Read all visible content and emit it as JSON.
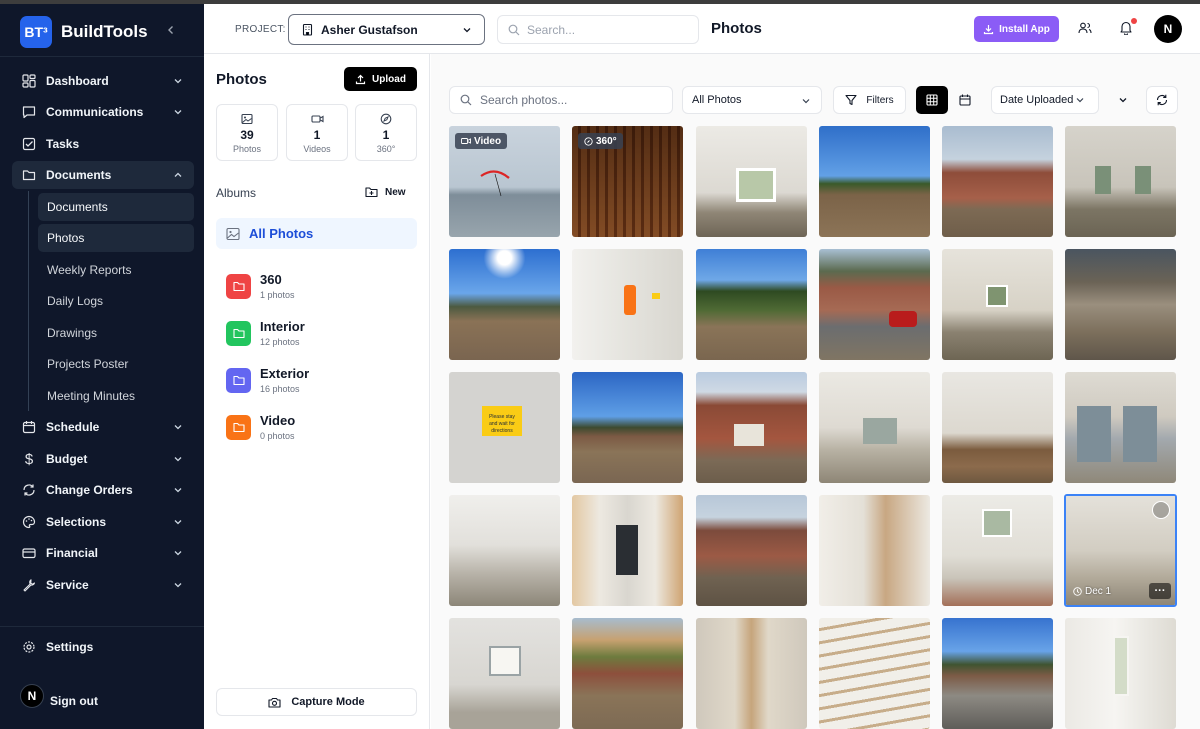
{
  "brand": {
    "logo": "BT³",
    "name": "BuildTools"
  },
  "sidebar": {
    "nav": [
      {
        "label": "Dashboard",
        "icon": "dashboard-icon"
      },
      {
        "label": "Communications",
        "icon": "chat-icon"
      },
      {
        "label": "Tasks",
        "icon": "task-check-icon"
      },
      {
        "label": "Documents",
        "icon": "folder-icon"
      },
      {
        "label": "Schedule",
        "icon": "calendar-icon"
      },
      {
        "label": "Budget",
        "icon": "dollar-icon"
      },
      {
        "label": "Change Orders",
        "icon": "refresh-icon"
      },
      {
        "label": "Selections",
        "icon": "palette-icon"
      },
      {
        "label": "Financial",
        "icon": "card-icon"
      },
      {
        "label": "Service",
        "icon": "wrench-icon"
      }
    ],
    "document_items": [
      {
        "label": "Documents"
      },
      {
        "label": "Photos"
      },
      {
        "label": "Weekly Reports"
      },
      {
        "label": "Daily Logs"
      },
      {
        "label": "Drawings"
      },
      {
        "label": "Projects Poster"
      },
      {
        "label": "Meeting Minutes"
      }
    ],
    "settings_label": "Settings",
    "signout_label": "Sign out",
    "signout_avatar": "N"
  },
  "header": {
    "project_label": "PROJECT:",
    "project_value": "Asher Gustafson",
    "search_placeholder": "Search...",
    "title": "Photos",
    "install_label": "Install App",
    "avatar": "N"
  },
  "albums_panel": {
    "title": "Photos",
    "upload_label": "Upload",
    "stats": [
      {
        "value": "39",
        "label": "Photos"
      },
      {
        "value": "1",
        "label": "Videos"
      },
      {
        "value": "1",
        "label": "360°"
      }
    ],
    "albums_heading": "Albums",
    "new_label": "New",
    "all_photos_label": "All Photos",
    "albums": [
      {
        "name": "360",
        "count": "1 photos",
        "color": "#ef4444"
      },
      {
        "name": "Interior",
        "count": "12 photos",
        "color": "#22c55e"
      },
      {
        "name": "Exterior",
        "count": "16 photos",
        "color": "#6366f1"
      },
      {
        "name": "Video",
        "count": "0 photos",
        "color": "#f97316"
      }
    ],
    "capture_label": "Capture Mode"
  },
  "toolbar": {
    "search_placeholder": "Search photos...",
    "filter_value": "All Photos",
    "filters_label": "Filters",
    "sort_value": "Date Uploaded"
  },
  "photos": {
    "badge_video": "Video",
    "badge_360": "360°",
    "selected_date": "Dec 1",
    "sign_text": "Please stay\nand wait for\ndirections",
    "colors": {
      "beach": [
        "#c7d2dc",
        "#8fa0ad",
        "#9aa6ae"
      ],
      "framing": [
        "#b98d62",
        "#7a5232"
      ],
      "interior_white": [
        "#e5e4df",
        "#b8b2a6"
      ],
      "sky_dirt": [
        "#4b89d6",
        "#8a7258"
      ],
      "brick_house": [
        "#9db2c6",
        "#8a5040",
        "#7b6a55"
      ],
      "room_window": [
        "#d9d5cc",
        "#7f8a74"
      ]
    }
  }
}
